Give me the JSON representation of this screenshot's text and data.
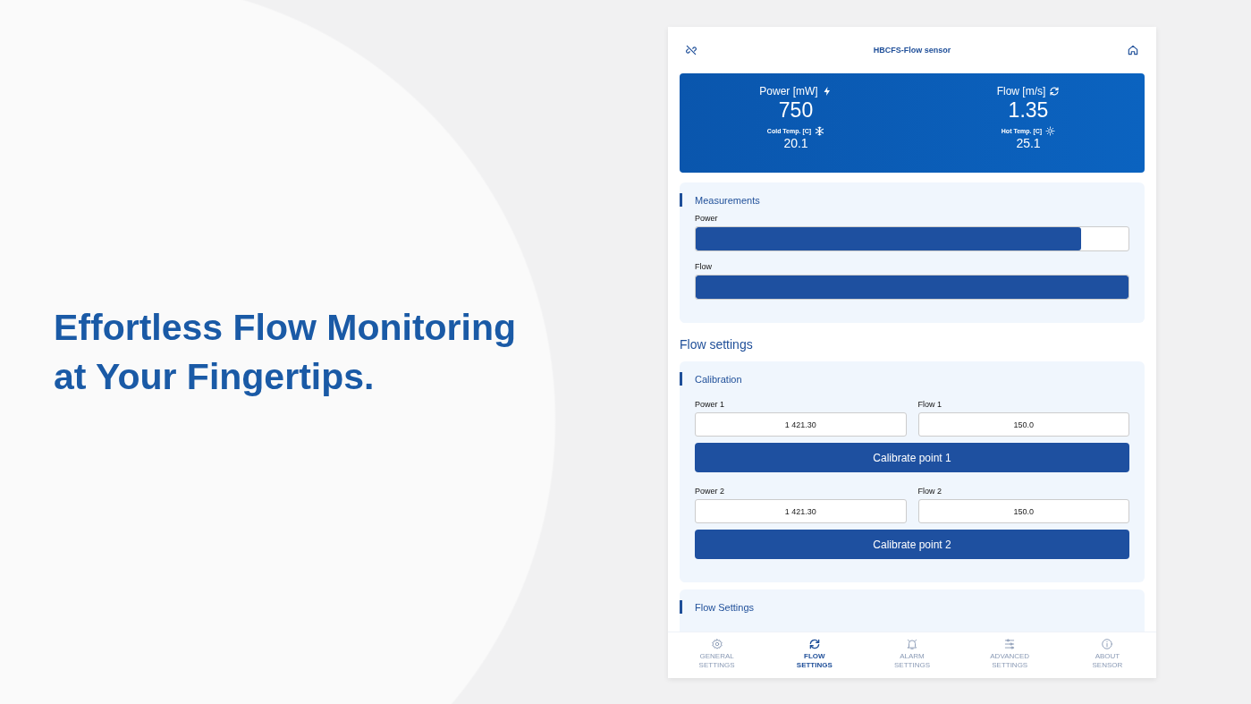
{
  "headline": {
    "lines": [
      "Effortless Flow Monitoring",
      "at Your Fingertips."
    ]
  },
  "app": {
    "title": "HBCFS-Flow sensor",
    "summary": {
      "primary": [
        {
          "label": "Power [mW]",
          "value": "750"
        },
        {
          "label": "Flow [m/s]",
          "value": "1.35"
        }
      ],
      "secondary": [
        {
          "label": "Cold Temp. [C]",
          "value": "20.1"
        },
        {
          "label": "Hot Temp. [C]",
          "value": "25.1"
        }
      ]
    },
    "measurements": {
      "title": "Measurements",
      "bars": [
        {
          "label": "Power",
          "level": 0.89
        },
        {
          "label": "Flow",
          "level": 1.0
        }
      ]
    },
    "section_title": "Flow settings",
    "calibration": {
      "title": "Calibration",
      "points": [
        {
          "fields": [
            {
              "label": "Power 1",
              "value": "1 421.30"
            },
            {
              "label": "Flow 1",
              "value": "150.0"
            }
          ],
          "button": "Calibrate point 1"
        },
        {
          "fields": [
            {
              "label": "Power 2",
              "value": "1 421.30"
            },
            {
              "label": "Flow 2",
              "value": "150.0"
            }
          ],
          "button": "Calibrate point 2"
        }
      ]
    },
    "flow_settings": {
      "title": "Flow Settings"
    },
    "nav": [
      {
        "lines": [
          "GENERAL",
          "SETTINGS"
        ],
        "selected": false
      },
      {
        "lines": [
          "FLOW",
          "SETTINGS"
        ],
        "selected": true
      },
      {
        "lines": [
          "ALARM",
          "SETTINGS"
        ],
        "selected": false
      },
      {
        "lines": [
          "ADVANCED",
          "SETTINGS"
        ],
        "selected": false
      },
      {
        "lines": [
          "ABOUT",
          "SENSOR"
        ],
        "selected": false
      }
    ]
  }
}
